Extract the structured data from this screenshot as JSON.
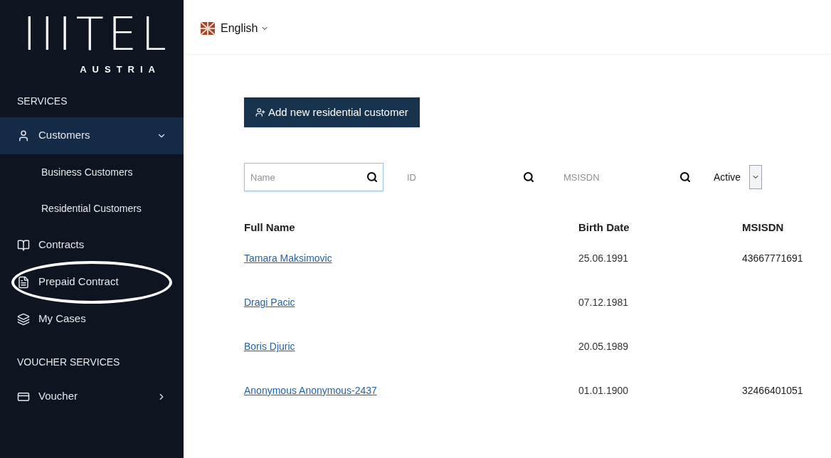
{
  "logo": {
    "mark": "IIITEL",
    "subtitle": "AUSTRIA"
  },
  "sidebar": {
    "sections": [
      {
        "title": "SERVICES",
        "items": [
          {
            "label": "Customers",
            "selected": true,
            "expanded": true,
            "circled": false,
            "children": [
              {
                "label": "Business Customers"
              },
              {
                "label": "Residential Customers"
              }
            ]
          },
          {
            "label": "Contracts",
            "selected": false,
            "circled": false
          },
          {
            "label": "Prepaid Contract",
            "selected": false,
            "circled": true
          },
          {
            "label": "My Cases",
            "selected": false,
            "circled": false
          }
        ]
      },
      {
        "title": "VOUCHER SERVICES",
        "items": [
          {
            "label": "Voucher",
            "selected": false,
            "expanded": false,
            "circled": false
          }
        ]
      }
    ]
  },
  "language": {
    "label": "English"
  },
  "add_button": {
    "label": "Add new residential customer"
  },
  "filters": {
    "searches": [
      {
        "placeholder": "Name",
        "focused": true
      },
      {
        "placeholder": "ID",
        "focused": false
      },
      {
        "placeholder": "MSISDN",
        "focused": false
      }
    ],
    "status": "Active"
  },
  "table": {
    "columns": [
      "Full Name",
      "Birth Date",
      "MSISDN"
    ],
    "rows": [
      {
        "name": "Tamara Maksimovic",
        "birth_date": "25.06.1991",
        "msisdn": "43667771691"
      },
      {
        "name": "Dragi Pacic",
        "birth_date": "07.12.1981"
      },
      {
        "name": "Boris Djuric",
        "birth_date": "20.05.1989"
      },
      {
        "name": "Anonymous Anonymous-2437",
        "birth_date": "01.01.1900",
        "msisdn": "32466401051"
      }
    ]
  }
}
